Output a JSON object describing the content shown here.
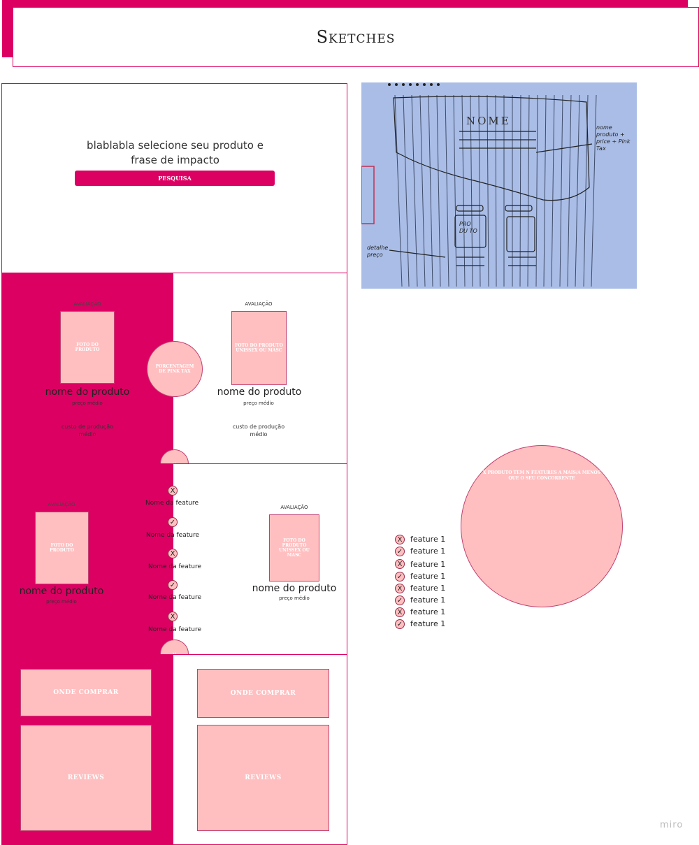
{
  "header": {
    "title": "Sketches"
  },
  "hero": {
    "text": "blablabla selecione seu produto e frase de impacto",
    "button": "PESQUISA"
  },
  "compare": {
    "left": {
      "rating": "AVALIAÇÃO",
      "photo": "FOTO DO PRODUTO",
      "name": "nome do produto",
      "price": "preço médio",
      "cost": "custo de produção médio"
    },
    "right": {
      "rating": "AVALIAÇÃO",
      "photo": "FOTO DO PRODUTO UNISSEX OU MASC",
      "name": "nome do produto",
      "price": "preço médio",
      "cost": "custo de produção médio"
    },
    "badge": "PORCENTAGEM DE PINK TAX",
    "chevron": "v"
  },
  "features": {
    "left": {
      "rating": "AVALIAÇÃO",
      "photo": "FOTO DO PRODUTO",
      "name": "nome do produto",
      "price": "preço médio"
    },
    "right": {
      "rating": "AVALIAÇÃO",
      "photo": "FOTO DO PRODUTO UNISSEX OU MASC",
      "name": "nome do produto",
      "price": "preço médio"
    },
    "items": [
      {
        "mark": "X",
        "label": "Nome da feature"
      },
      {
        "mark": "✓",
        "label": "Nome da feature"
      },
      {
        "mark": "X",
        "label": "Nome da feature"
      },
      {
        "mark": "✓",
        "label": "Nome da feature"
      },
      {
        "mark": "X",
        "label": "Nome da feature"
      }
    ],
    "chevron": "v"
  },
  "buy": {
    "left": {
      "where": "ONDE COMPRAR",
      "reviews": "REVIEWS"
    },
    "right": {
      "where": "ONDE COMPRAR",
      "reviews": "REVIEWS"
    }
  },
  "sketch": {
    "heading": "NOME",
    "note": "nome produto + price + Pink Tax",
    "photo": "PRO DU TO",
    "detail": "detalhe preço"
  },
  "side": {
    "circle_text": "X PRODUTO TEM N FEATURES A MAIS/A MENOS QUE O SEU CONCORRENTE",
    "list": [
      {
        "mark": "X",
        "label": "feature 1"
      },
      {
        "mark": "✓",
        "label": "feature 1"
      },
      {
        "mark": "X",
        "label": "feature 1"
      },
      {
        "mark": "✓",
        "label": "feature 1"
      },
      {
        "mark": "X",
        "label": "feature 1"
      },
      {
        "mark": "✓",
        "label": "feature 1"
      },
      {
        "mark": "X",
        "label": "feature 1"
      },
      {
        "mark": "✓",
        "label": "feature 1"
      }
    ]
  },
  "watermark": "miro"
}
